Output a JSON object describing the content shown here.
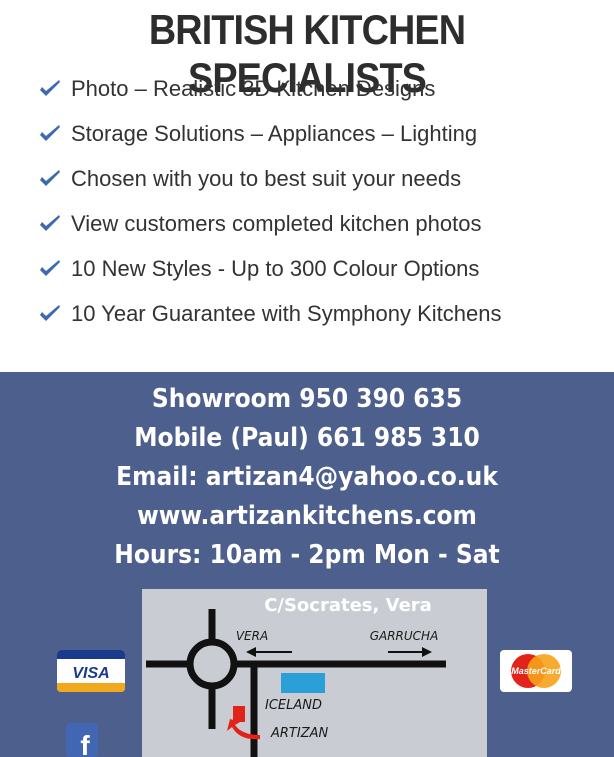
{
  "title": "BRITISH KITCHEN SPECIALISTS",
  "features": [
    "Photo – Realistic 3D Kitchen Designs",
    "Storage Solutions – Appliances – Lighting",
    "Chosen with you to best suit your needs",
    "View customers completed kitchen photos",
    "10 New Styles  -  Up to 300 Colour Options",
    "10 Year Guarantee with Symphony Kitchens"
  ],
  "contact": {
    "showroom": "Showroom 950 390 635",
    "mobile": "Mobile (Paul) 661 985 310",
    "email": "Email: artizan4@yahoo.co.uk",
    "website": "www.artizankitchens.com",
    "hours": "Hours: 10am - 2pm Mon - Sat"
  },
  "map": {
    "street": "C/Socrates, Vera",
    "left_dir": "VERA",
    "right_dir": "GARRUCHA",
    "landmark": "ICELAND",
    "shop": "ARTIZAN"
  },
  "payments": {
    "visa": "VISA",
    "mastercard": "MasterCard"
  },
  "social": {
    "facebook": "f"
  },
  "colors": {
    "banner": "#4d5f8c",
    "check": "#3d6aaf",
    "iceland": "#2a9fd8",
    "artizan_marker": "#e2231a"
  }
}
